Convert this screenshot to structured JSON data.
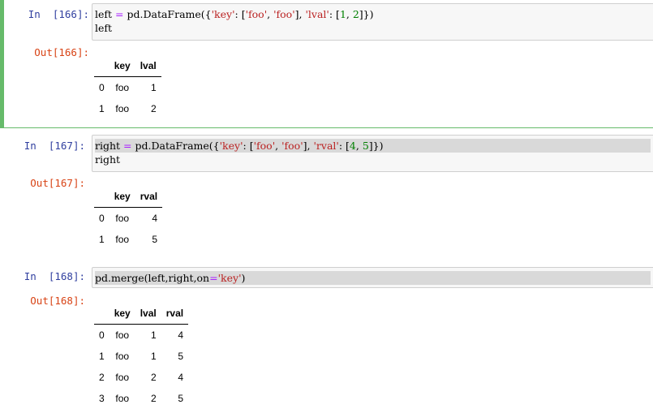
{
  "cells": [
    {
      "in_prompt": "In  [166]:",
      "out_prompt": "Out[166]:",
      "code_lines": [
        [
          {
            "t": "left ",
            "c": ""
          },
          {
            "t": "=",
            "c": "op"
          },
          {
            "t": " pd.DataFrame({",
            "c": ""
          },
          {
            "t": "'key'",
            "c": "str"
          },
          {
            "t": ": [",
            "c": ""
          },
          {
            "t": "'foo'",
            "c": "str"
          },
          {
            "t": ", ",
            "c": ""
          },
          {
            "t": "'foo'",
            "c": "str"
          },
          {
            "t": "], ",
            "c": ""
          },
          {
            "t": "'lval'",
            "c": "str"
          },
          {
            "t": ": [",
            "c": ""
          },
          {
            "t": "1",
            "c": "num"
          },
          {
            "t": ", ",
            "c": ""
          },
          {
            "t": "2",
            "c": "num"
          },
          {
            "t": "]})",
            "c": ""
          }
        ],
        [
          {
            "t": "left",
            "c": ""
          }
        ]
      ],
      "table": {
        "columns": [
          "key",
          "lval"
        ],
        "rows": [
          {
            "index": "0",
            "values": [
              "foo",
              "1"
            ]
          },
          {
            "index": "1",
            "values": [
              "foo",
              "2"
            ]
          }
        ]
      }
    },
    {
      "in_prompt": "In  [167]:",
      "out_prompt": "Out[167]:",
      "code_lines": [
        [
          {
            "t": "right ",
            "c": ""
          },
          {
            "t": "=",
            "c": "op"
          },
          {
            "t": " pd.DataFrame({",
            "c": ""
          },
          {
            "t": "'key'",
            "c": "str"
          },
          {
            "t": ": [",
            "c": ""
          },
          {
            "t": "'foo'",
            "c": "str"
          },
          {
            "t": ", ",
            "c": ""
          },
          {
            "t": "'foo'",
            "c": "str"
          },
          {
            "t": "], ",
            "c": ""
          },
          {
            "t": "'rval'",
            "c": "str"
          },
          {
            "t": ": [",
            "c": ""
          },
          {
            "t": "4",
            "c": "num"
          },
          {
            "t": ", ",
            "c": ""
          },
          {
            "t": "5",
            "c": "num"
          },
          {
            "t": "]})",
            "c": ""
          }
        ],
        [
          {
            "t": "right",
            "c": ""
          }
        ]
      ],
      "table": {
        "columns": [
          "key",
          "rval"
        ],
        "rows": [
          {
            "index": "0",
            "values": [
              "foo",
              "4"
            ]
          },
          {
            "index": "1",
            "values": [
              "foo",
              "5"
            ]
          }
        ]
      }
    },
    {
      "in_prompt": "In  [168]:",
      "out_prompt": "Out[168]:",
      "code_lines": [
        [
          {
            "t": "pd.merge(left,right,on",
            "c": ""
          },
          {
            "t": "=",
            "c": "op"
          },
          {
            "t": "'key'",
            "c": "str"
          },
          {
            "t": ")",
            "c": ""
          }
        ]
      ],
      "table": {
        "columns": [
          "key",
          "lval",
          "rval"
        ],
        "rows": [
          {
            "index": "0",
            "values": [
              "foo",
              "1",
              "4"
            ]
          },
          {
            "index": "1",
            "values": [
              "foo",
              "1",
              "5"
            ]
          },
          {
            "index": "2",
            "values": [
              "foo",
              "2",
              "4"
            ]
          },
          {
            "index": "3",
            "values": [
              "foo",
              "2",
              "5"
            ]
          }
        ]
      }
    }
  ],
  "colors": {
    "selected_border": "#66bb6a",
    "in_prompt": "#303f9f",
    "out_prompt": "#d84315",
    "string": "#ba2121",
    "number": "#008000",
    "operator": "#aa22ff"
  }
}
